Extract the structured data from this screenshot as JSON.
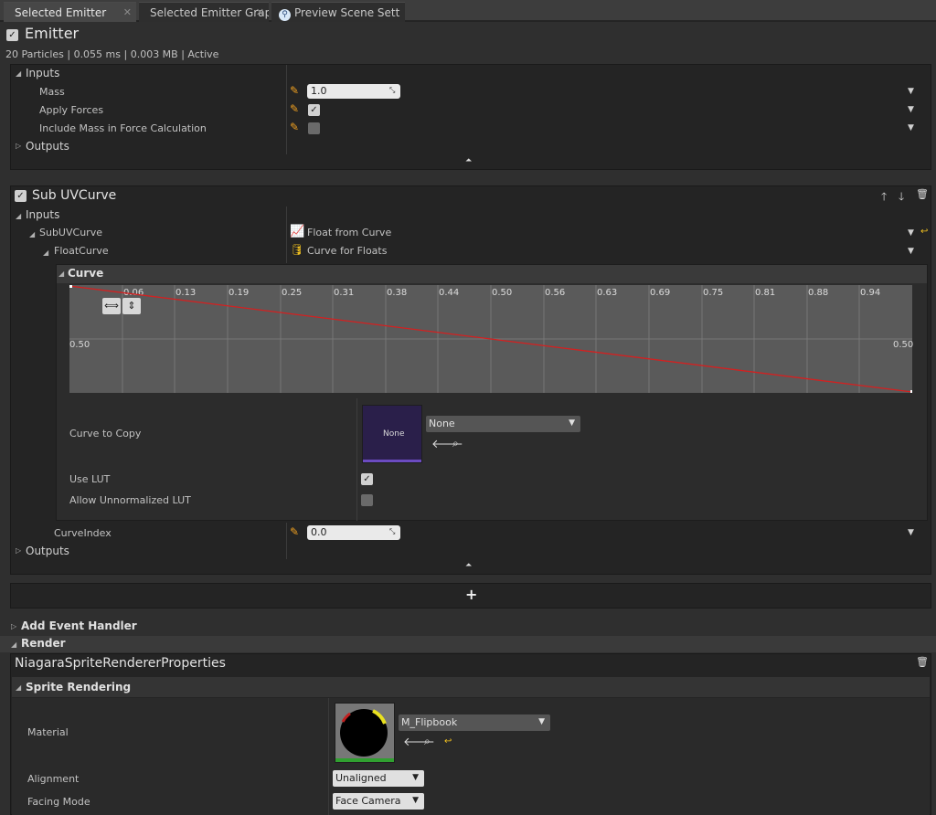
{
  "tabs": [
    {
      "label": "Selected Emitter"
    },
    {
      "label": "Selected Emitter Grapl"
    },
    {
      "label": "Preview Scene Sett"
    }
  ],
  "emitter": {
    "title": "Emitter",
    "enabled": true,
    "stats": "20 Particles | 0.055 ms | 0.003 MB | Active",
    "inputs_label": "Inputs",
    "outputs_label": "Outputs",
    "rows": [
      {
        "label": "Mass",
        "value": "1.0"
      },
      {
        "label": "Apply Forces",
        "checked": true
      },
      {
        "label": "Include Mass in Force Calculation",
        "checked": false
      }
    ]
  },
  "subuv": {
    "title": "Sub UVCurve",
    "enabled": true,
    "inputs_label": "Inputs",
    "outputs_label": "Outputs",
    "subuvcurve_label": "SubUVCurve",
    "subuvcurve_value": "Float from Curve",
    "floatcurve_label": "FloatCurve",
    "floatcurve_value": "Curve for Floats",
    "curve_section": "Curve",
    "curve_ticks": [
      "0.06",
      "0.13",
      "0.19",
      "0.25",
      "0.31",
      "0.38",
      "0.44",
      "0.50",
      "0.56",
      "0.63",
      "0.69",
      "0.75",
      "0.81",
      "0.88",
      "0.94"
    ],
    "curve_left_value": "0.50",
    "curve_right_value": "0.50",
    "curve_to_copy_label": "Curve to Copy",
    "curve_to_copy_thumb": "None",
    "curve_to_copy_value": "None",
    "use_lut_label": "Use LUT",
    "use_lut": true,
    "allow_unnormalized_label": "Allow Unnormalized LUT",
    "allow_unnormalized": false,
    "curveindex_label": "CurveIndex",
    "curveindex_value": "0.0"
  },
  "add_button": "+",
  "add_event_handler": "Add Event Handler",
  "render_label": "Render",
  "renderer": {
    "title": "NiagaraSpriteRendererProperties",
    "sprite_rendering": "Sprite Rendering",
    "material_label": "Material",
    "material_value": "M_Flipbook",
    "alignment_label": "Alignment",
    "alignment_value": "Unaligned",
    "facing_label": "Facing Mode",
    "facing_value": "Face Camera"
  },
  "colors": {
    "curve_line": "#d42020",
    "accent_orange": "#f0a020",
    "curve_icon": "#3fb8e0",
    "floats_icon": "#f0c020"
  },
  "icons": {
    "checkbox": "check-icon",
    "pencil": "pencil-icon",
    "trash": "trash-icon",
    "arrow_up": "arrow-up-icon",
    "arrow_down": "arrow-down-icon",
    "reset": "reset-arrow-icon",
    "search": "search-icon",
    "back": "use-selected-icon"
  }
}
